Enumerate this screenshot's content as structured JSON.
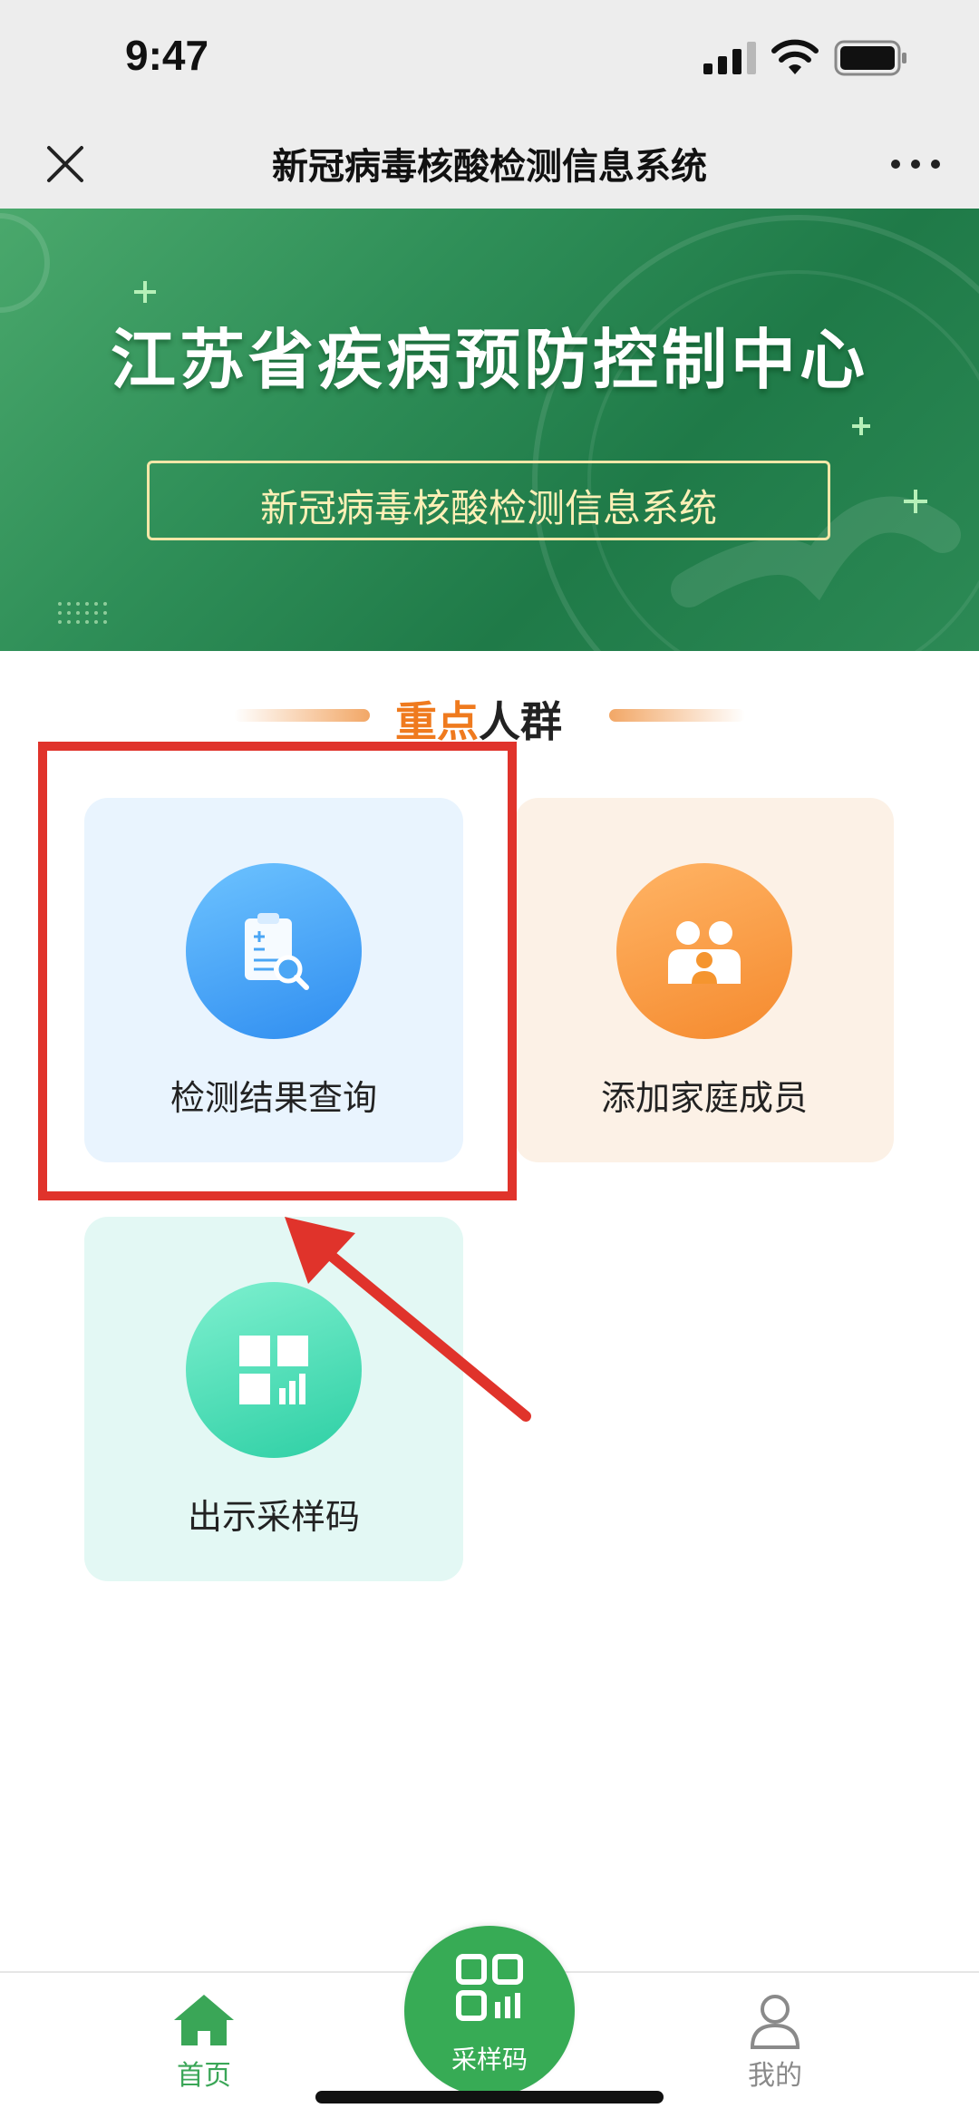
{
  "status_bar": {
    "time": "9:47",
    "icons": [
      "signal-icon",
      "wifi-icon",
      "battery-icon"
    ]
  },
  "nav_bar": {
    "title": "新冠病毒核酸检测信息系统",
    "left_icon": "close-icon",
    "right_icon": "more-icon"
  },
  "banner": {
    "title": "江苏省疾病预防控制中心",
    "subtitle": "新冠病毒核酸检测信息系统"
  },
  "section": {
    "title_highlight": "重点",
    "title_rest": "人群"
  },
  "cards": [
    {
      "label": "检测结果查询",
      "icon": "clipboard-search-icon"
    },
    {
      "label": "添加家庭成员",
      "icon": "family-icon"
    },
    {
      "label": "出示采样码",
      "icon": "qr-chart-icon"
    }
  ],
  "tab_bar": {
    "home_label": "首页",
    "sample_label": "采样码",
    "mine_label": "我的",
    "active_tab": "首页"
  },
  "colors": {
    "primary_green": "#37ab55",
    "banner_green": "#2f8f58",
    "highlight_orange": "#ef7a1e",
    "annotation_red": "#e0332b",
    "nav_background": "#ededed"
  }
}
